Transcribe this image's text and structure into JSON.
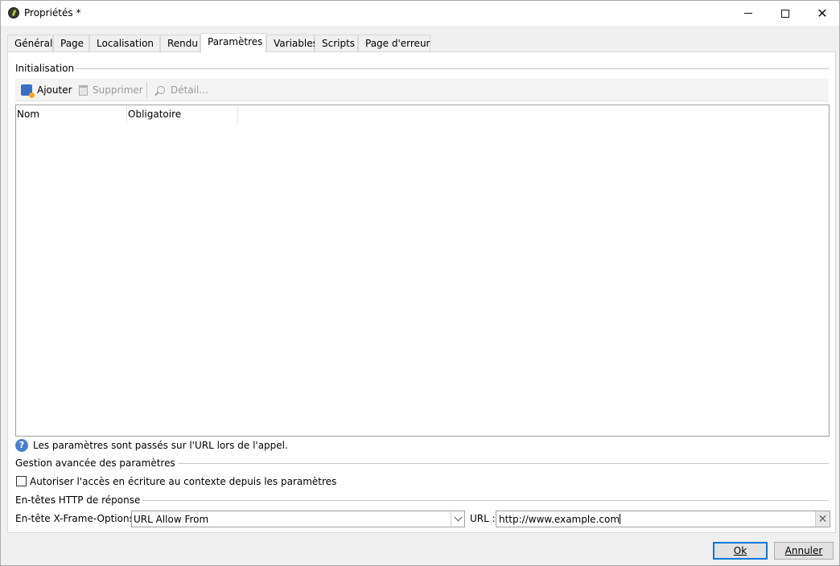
{
  "window": {
    "title": "Propriétés *",
    "min_label": "—",
    "close_label": "✕"
  },
  "tabs": [
    {
      "label": "Général"
    },
    {
      "label": "Page"
    },
    {
      "label": "Localisation"
    },
    {
      "label": "Rendu"
    },
    {
      "label": "Paramètres",
      "active": true
    },
    {
      "label": "Variables"
    },
    {
      "label": "Scripts"
    },
    {
      "label": "Page d'erreur"
    }
  ],
  "initialisation": {
    "title": "Initialisation",
    "toolbar": {
      "add_label": "Ajouter",
      "delete_label": "Supprimer",
      "detail_label": "Détail..."
    },
    "columns": [
      "Nom",
      "Obligatoire"
    ],
    "rows": []
  },
  "info": {
    "icon": "?",
    "text": "Les paramètres sont passés sur l'URL lors de l'appel."
  },
  "advanced": {
    "title": "Gestion avancée des paramètres",
    "checkbox_label": "Autoriser l'accès en écriture au contexte depuis les paramètres",
    "checked": false
  },
  "http_headers": {
    "title": "En-têtes HTTP de réponse",
    "xframe_label": "En-tête X-Frame-Options :",
    "xframe_value": "URL Allow From",
    "url_label": "URL :",
    "url_value": "http://www.example.com",
    "clear_glyph": "✕"
  },
  "buttons": {
    "ok_label": "Ok",
    "cancel_label": "Annuler"
  },
  "colors": {
    "accent": "#0078d7",
    "info_icon": "#4a7fcf"
  }
}
